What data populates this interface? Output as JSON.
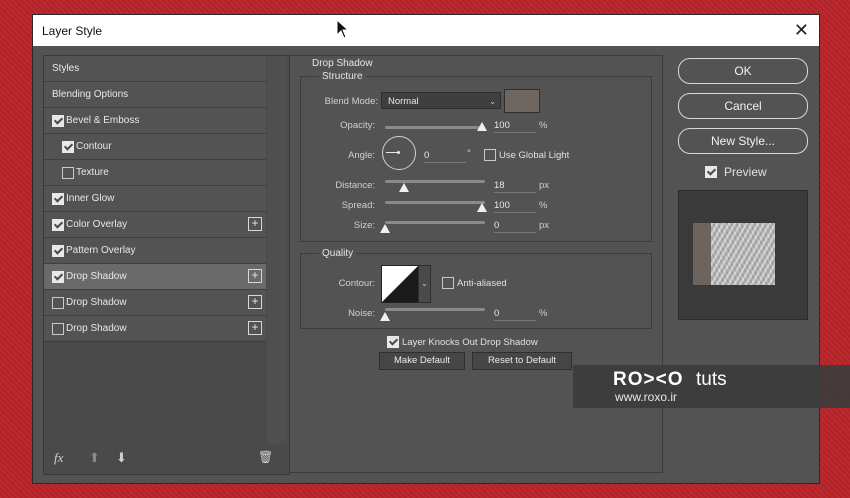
{
  "window": {
    "title": "Layer Style",
    "close_glyph": "✕"
  },
  "styles_list": [
    {
      "label": "Styles",
      "checkbox": false,
      "checked": false,
      "indent": false,
      "plus": false,
      "selected": false
    },
    {
      "label": "Blending Options",
      "checkbox": false,
      "checked": false,
      "indent": false,
      "plus": false,
      "selected": false
    },
    {
      "label": "Bevel & Emboss",
      "checkbox": true,
      "checked": true,
      "indent": false,
      "plus": false,
      "selected": false
    },
    {
      "label": "Contour",
      "checkbox": true,
      "checked": true,
      "indent": true,
      "plus": false,
      "selected": false
    },
    {
      "label": "Texture",
      "checkbox": true,
      "checked": false,
      "indent": true,
      "plus": false,
      "selected": false
    },
    {
      "label": "Inner Glow",
      "checkbox": true,
      "checked": true,
      "indent": false,
      "plus": false,
      "selected": false
    },
    {
      "label": "Color Overlay",
      "checkbox": true,
      "checked": true,
      "indent": false,
      "plus": true,
      "selected": false
    },
    {
      "label": "Pattern Overlay",
      "checkbox": true,
      "checked": true,
      "indent": false,
      "plus": false,
      "selected": false
    },
    {
      "label": "Drop Shadow",
      "checkbox": true,
      "checked": true,
      "indent": false,
      "plus": true,
      "selected": true
    },
    {
      "label": "Drop Shadow",
      "checkbox": true,
      "checked": false,
      "indent": false,
      "plus": true,
      "selected": false
    },
    {
      "label": "Drop Shadow",
      "checkbox": true,
      "checked": false,
      "indent": false,
      "plus": true,
      "selected": false
    }
  ],
  "plus_glyph": "+",
  "bottom_toolbar": {
    "fx": "fx",
    "up": "⬆",
    "down": "⬇",
    "trash": "🗑"
  },
  "drop_shadow": {
    "group_title": "Drop Shadow",
    "structure_title": "Structure",
    "blend_mode_label": "Blend Mode:",
    "blend_mode_value": "Normal",
    "shadow_color": "#6e6661",
    "opacity_label": "Opacity:",
    "opacity_value": "100",
    "opacity_unit": "%",
    "angle_label": "Angle:",
    "angle_value": "0",
    "angle_unit": "°",
    "global_light_label": "Use Global Light",
    "global_light_checked": false,
    "distance_label": "Distance:",
    "distance_value": "18",
    "distance_unit": "px",
    "spread_label": "Spread:",
    "spread_value": "100",
    "spread_unit": "%",
    "size_label": "Size:",
    "size_value": "0",
    "size_unit": "px",
    "quality_title": "Quality",
    "contour_label": "Contour:",
    "anti_aliased_label": "Anti-aliased",
    "anti_aliased_checked": false,
    "noise_label": "Noise:",
    "noise_value": "0",
    "noise_unit": "%",
    "knocks_out_label": "Layer Knocks Out Drop Shadow",
    "knocks_out_checked": true,
    "make_default_label": "Make Default",
    "reset_default_label": "Reset to Default"
  },
  "actions": {
    "ok_label": "OK",
    "cancel_label": "Cancel",
    "new_style_label": "New Style...",
    "preview_label": "Preview",
    "preview_checked": true
  },
  "watermark": {
    "brand": "RO><O",
    "tuts": "tuts",
    "url": "www.roxo.ir"
  }
}
